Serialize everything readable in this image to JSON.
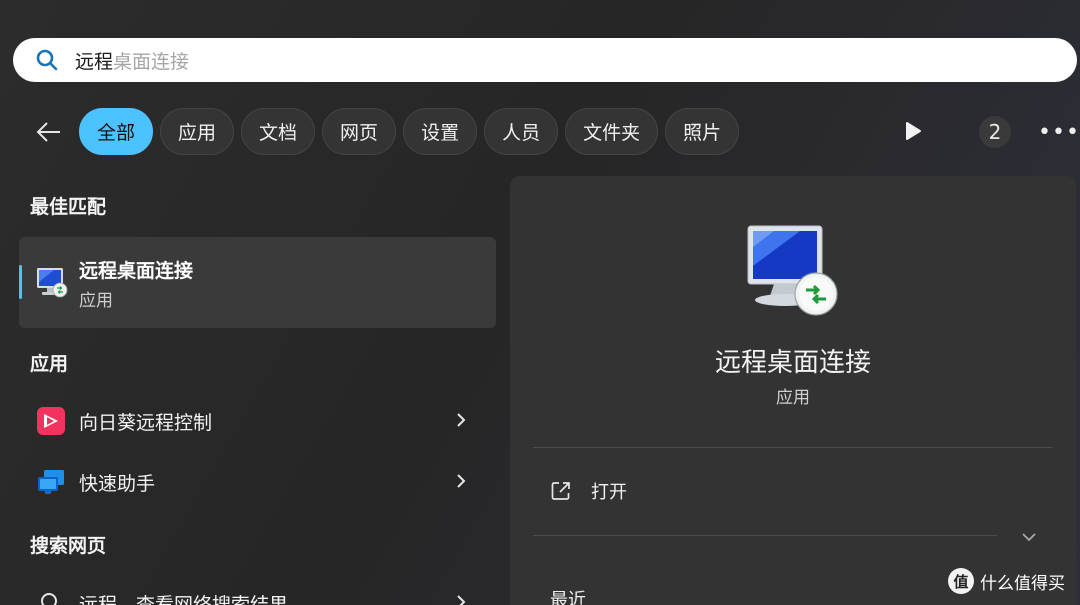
{
  "search": {
    "typed": "远程",
    "suggestion": "桌面连接"
  },
  "filters": [
    "全部",
    "应用",
    "文档",
    "网页",
    "设置",
    "人员",
    "文件夹",
    "照片"
  ],
  "toolbar": {
    "count": "2",
    "more": "•••"
  },
  "sections": {
    "best_match": "最佳匹配",
    "apps": "应用",
    "web": "搜索网页"
  },
  "best_match": {
    "name": "远程桌面连接",
    "type": "应用"
  },
  "apps": [
    {
      "name": "向日葵远程控制",
      "icon": "sunlogin-icon"
    },
    {
      "name": "快速助手",
      "icon": "quick-assist-icon"
    }
  ],
  "web_result": {
    "query": "远程",
    "suffix": " - 查看网络搜索结果"
  },
  "detail": {
    "title": "远程桌面连接",
    "subtitle": "应用",
    "open_label": "打开",
    "recent_label": "最近"
  },
  "watermark": {
    "logo": "值",
    "text": "什么值得买"
  },
  "colors": {
    "accent": "#4cc2ff",
    "background": "#262626",
    "panel": "#333333"
  }
}
